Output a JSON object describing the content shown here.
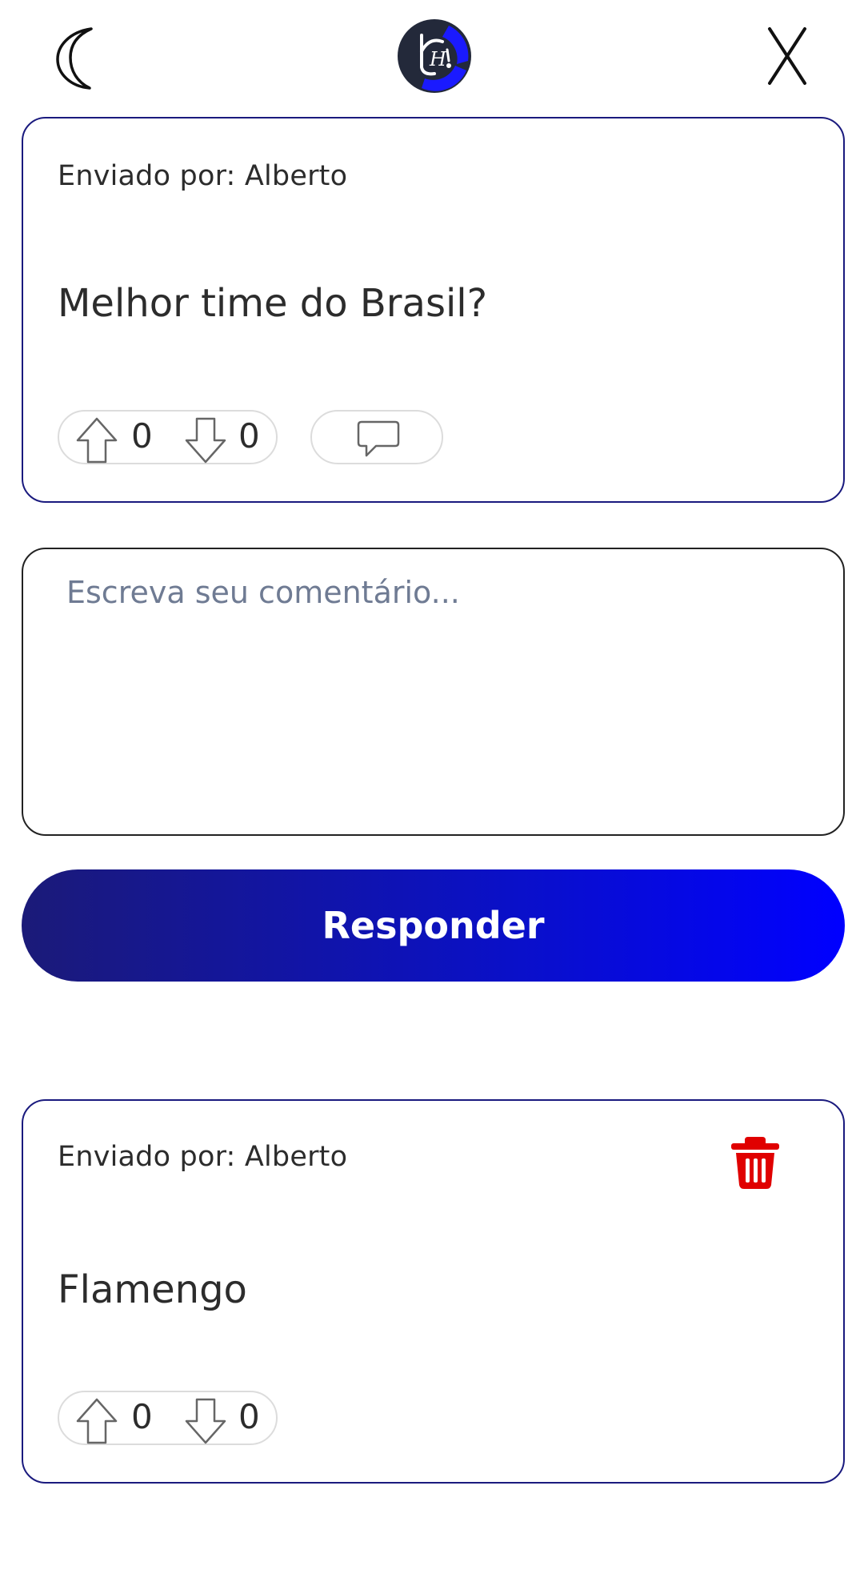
{
  "header": {
    "theme_toggle_icon": "moon-icon",
    "logo_icon": "app-logo",
    "close_icon": "close-icon"
  },
  "post": {
    "sender": "Enviado por: Alberto",
    "text": "Melhor time do Brasil?",
    "upvotes": "0",
    "downvotes": "0",
    "comment_icon": "comment-icon"
  },
  "comment_form": {
    "placeholder": "Escreva seu comentário...",
    "submit_label": "Responder"
  },
  "replies": [
    {
      "sender": "Enviado por: Alberto",
      "text": "Flamengo",
      "upvotes": "0",
      "downvotes": "0",
      "delete_icon": "trash-icon"
    }
  ],
  "colors": {
    "card_border": "#1a1a7e",
    "button_gradient_start": "#1b1a78",
    "button_gradient_end": "#0000ff",
    "delete_red": "#e00000",
    "placeholder": "#6f7b93"
  }
}
